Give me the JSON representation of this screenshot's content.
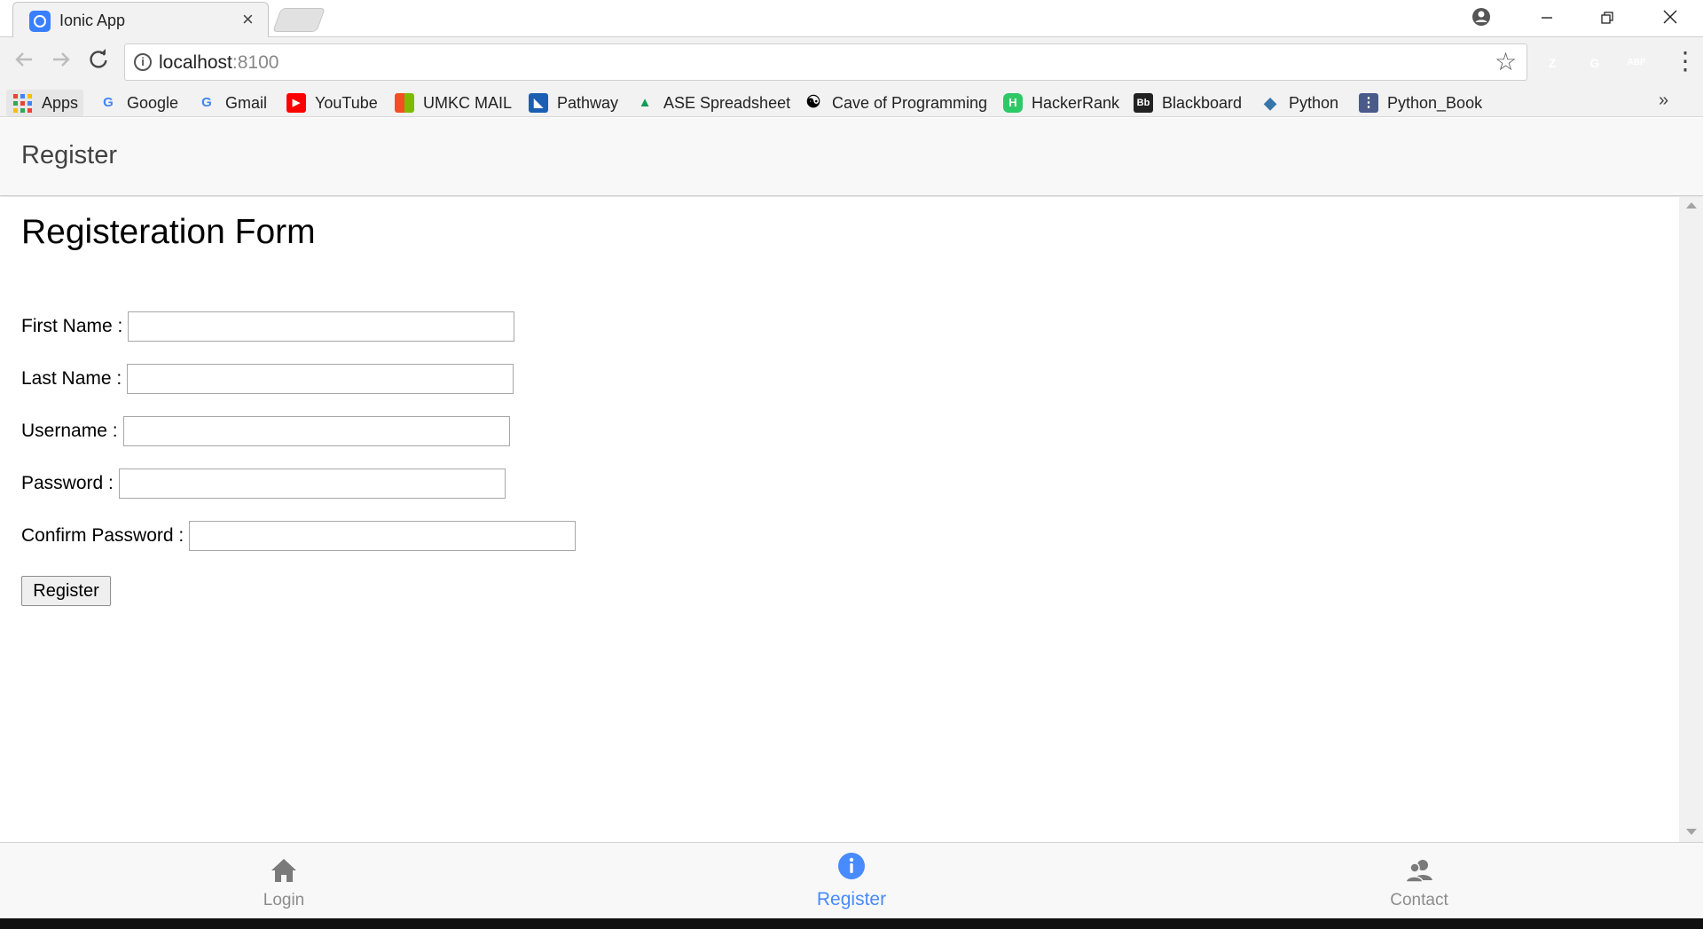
{
  "browser": {
    "tab_title": "Ionic App",
    "tab_close": "×",
    "url_host": "localhost",
    "url_port": ":8100",
    "extensions": [
      {
        "name": "z-extension-icon",
        "label": "Z",
        "color": "#3a4fa8"
      },
      {
        "name": "grammarly-icon",
        "label": "G",
        "color": "#15c39a"
      },
      {
        "name": "adblock-plus-icon",
        "label": "ABP",
        "color": "#d7191f"
      }
    ],
    "bookmarks": [
      {
        "label": "Apps"
      },
      {
        "label": "Google",
        "icon": "G",
        "color": "#4285f4"
      },
      {
        "label": "Gmail",
        "icon": "G",
        "color": "#4285f4"
      },
      {
        "label": "YouTube",
        "icon": "▶",
        "color": "#ff0000"
      },
      {
        "label": "UMKC MAIL",
        "icon": "■",
        "color": "#f25022"
      },
      {
        "label": "Pathway",
        "icon": "◣",
        "color": "#1a5fb4"
      },
      {
        "label": "ASE Spreadsheet",
        "icon": "▲",
        "color": "#0f9d58"
      },
      {
        "label": "Cave of Programming",
        "icon": "☯",
        "color": "#000000"
      },
      {
        "label": "HackerRank",
        "icon": "H",
        "color": "#2ec866"
      },
      {
        "label": "Blackboard",
        "icon": "Bb",
        "color": "#222222"
      },
      {
        "label": "Python",
        "icon": "◆",
        "color": "#3776ab"
      },
      {
        "label": "Python_Book",
        "icon": "⋮",
        "color": "#4a5a8a"
      }
    ],
    "more_bookmarks": "»"
  },
  "app": {
    "header_title": "Register",
    "form_title": "Registeration Form",
    "fields": [
      {
        "label": "First Name :",
        "value": ""
      },
      {
        "label": "Last Name :",
        "value": ""
      },
      {
        "label": "Username :",
        "value": ""
      },
      {
        "label": "Password :",
        "value": ""
      },
      {
        "label": "Confirm Password :",
        "value": ""
      }
    ],
    "submit_label": "Register",
    "tabs": [
      {
        "label": "Login",
        "icon": "home-icon",
        "active": false
      },
      {
        "label": "Register",
        "icon": "information-circle-icon",
        "active": true
      },
      {
        "label": "Contact",
        "icon": "contacts-icon",
        "active": false
      }
    ],
    "accent_color": "#488aff"
  }
}
